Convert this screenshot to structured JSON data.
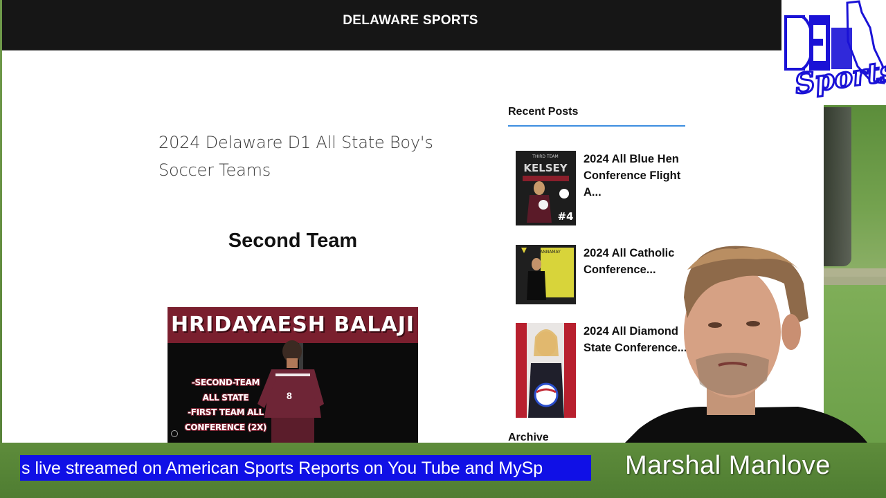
{
  "site": {
    "title": "DELAWARE SPORTS"
  },
  "logo": {
    "text_top": "DE",
    "text_script": "Sports",
    "brand_color": "#1a12d6"
  },
  "article": {
    "title": "2024 Delaware D1 All State Boy's Soccer Teams",
    "section_heading": "Second Team",
    "feature_image": {
      "name": "HRIDAYAESH BALAJI",
      "lines": [
        "-SECOND-TEAM",
        "ALL STATE",
        "-FIRST TEAM ALL",
        "CONFERENCE (2X)"
      ],
      "jersey_number": "8"
    }
  },
  "sidebar": {
    "recent_posts_heading": "Recent Posts",
    "posts": [
      {
        "title": "2024 All Blue Hen Conference Flight A...",
        "thumb_top": "THIRD TEAM",
        "thumb_name": "KELSEY",
        "thumb_number": "#4"
      },
      {
        "title": "2024 All Catholic Conference...",
        "thumb_top": "ANNAMAY"
      },
      {
        "title": "2024 All Diamond State Conference..."
      }
    ],
    "archive_heading": "Archive"
  },
  "stream": {
    "ticker": "s live streamed on American Sports Reports on You Tube and MySp",
    "presenter_name": "Marshal Manlove"
  },
  "colors": {
    "accent_rule": "#3c8de0",
    "ticker_bg": "#1010e6",
    "topbar": "#161616",
    "maroon": "#7a1f2e"
  }
}
